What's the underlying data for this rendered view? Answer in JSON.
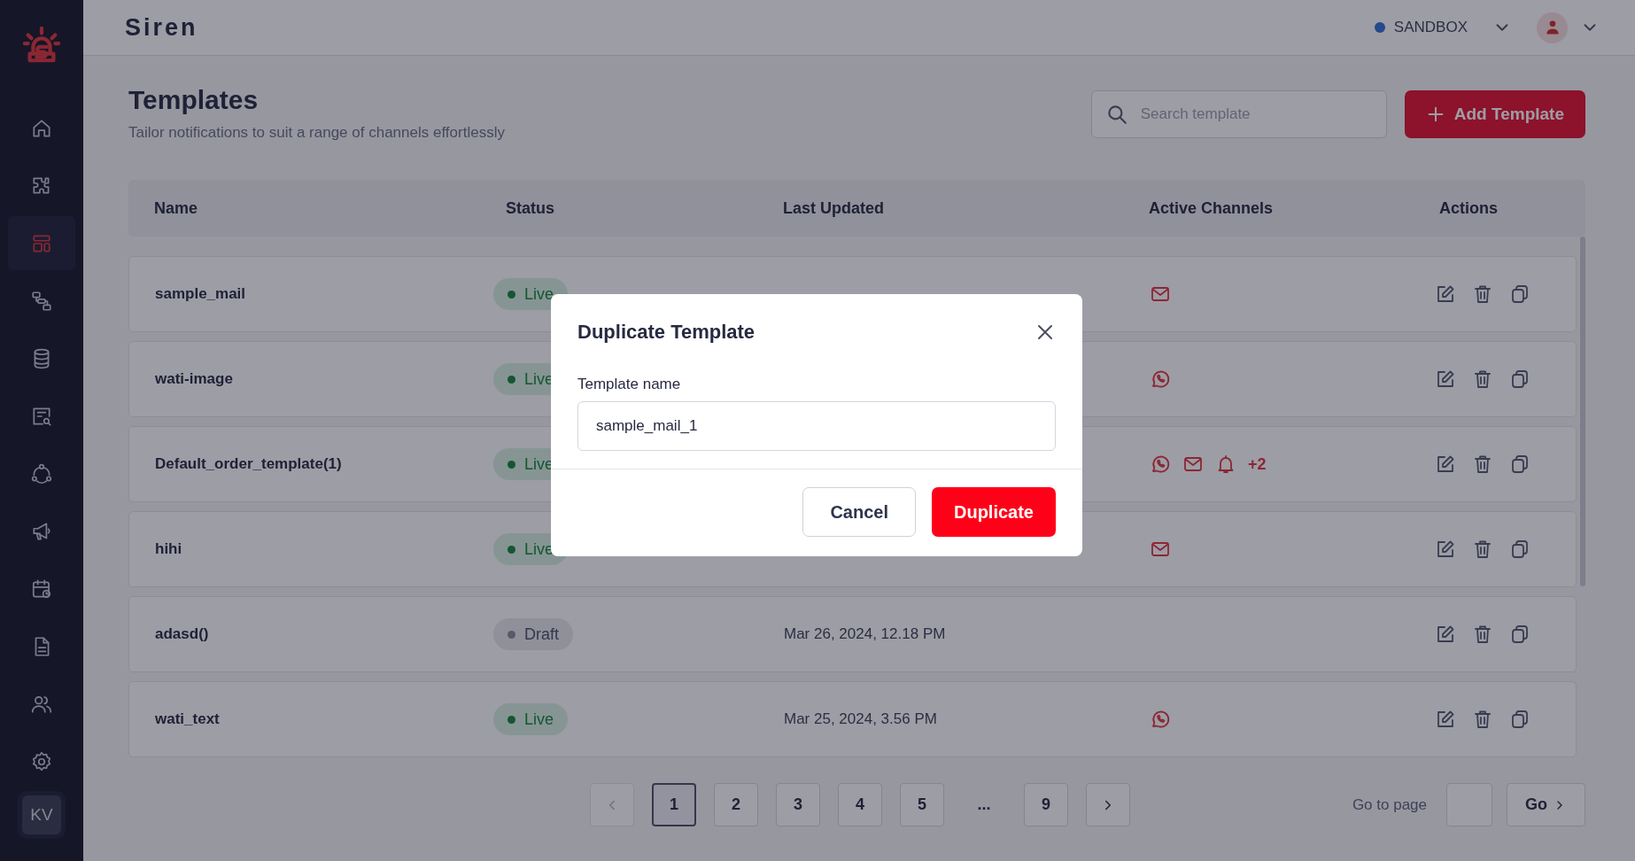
{
  "topbar": {
    "brand": "Siren",
    "environment": "SANDBOX"
  },
  "sidebar": {
    "items": [
      {
        "selected": false
      },
      {
        "selected": false
      },
      {
        "selected": true
      },
      {
        "selected": false
      },
      {
        "selected": false
      },
      {
        "selected": false
      },
      {
        "selected": false
      },
      {
        "selected": false
      },
      {
        "selected": false
      },
      {
        "selected": false
      },
      {
        "selected": false
      },
      {
        "selected": false
      }
    ],
    "avatar": "KV"
  },
  "page": {
    "title": "Templates",
    "subtitle": "Tailor notifications to suit a range of channels effortlessly",
    "search": {
      "placeholder": "Search template"
    },
    "add_button": "Add Template"
  },
  "table": {
    "columns": [
      "Name",
      "Status",
      "Last Updated",
      "Active Channels",
      "Actions"
    ],
    "rows": [
      {
        "name": "sample_mail",
        "status": {
          "kind": "live",
          "label": "Live"
        },
        "channels": [
          {
            "kind": "email"
          }
        ]
      },
      {
        "name": "wati-image",
        "status": {
          "kind": "live",
          "label": "Live"
        },
        "channels": [
          {
            "kind": "whatsapp"
          }
        ]
      },
      {
        "name": "Default_order_template(1)",
        "status": {
          "kind": "live",
          "label": "Live"
        },
        "channels": [
          {
            "kind": "whatsapp"
          },
          {
            "kind": "email"
          },
          {
            "kind": "bell"
          }
        ],
        "more_channels": "+2"
      },
      {
        "name": "hihi",
        "status": {
          "kind": "live",
          "label": "Live"
        },
        "channels": [
          {
            "kind": "email"
          }
        ]
      },
      {
        "name": "adasd()",
        "status": {
          "kind": "draft",
          "label": "Draft"
        },
        "last_updated": "Mar 26, 2024, 12.18 PM"
      },
      {
        "name": "wati_text",
        "status": {
          "kind": "live",
          "label": "Live"
        },
        "last_updated": "Mar 25, 2024, 3.56 PM",
        "channels": [
          {
            "kind": "whatsapp"
          }
        ]
      }
    ]
  },
  "pagination": {
    "prev": {
      "disabled": true
    },
    "pages": [
      {
        "kind": "page",
        "label": "1",
        "selected": true
      },
      {
        "kind": "page",
        "label": "2",
        "selected": false
      },
      {
        "kind": "page",
        "label": "3",
        "selected": false
      },
      {
        "kind": "page",
        "label": "4",
        "selected": false
      },
      {
        "kind": "page",
        "label": "5",
        "selected": false
      },
      {
        "kind": "ellipsis",
        "label": "..."
      },
      {
        "kind": "page",
        "label": "9",
        "selected": false
      }
    ],
    "next": {
      "disabled": false
    },
    "go_to_label": "Go to page",
    "go_button": "Go"
  },
  "modal": {
    "title": "Duplicate Template",
    "field_label": "Template name",
    "field_value": "sample_mail_1",
    "cancel_button": "Cancel",
    "confirm_button": "Duplicate"
  }
}
